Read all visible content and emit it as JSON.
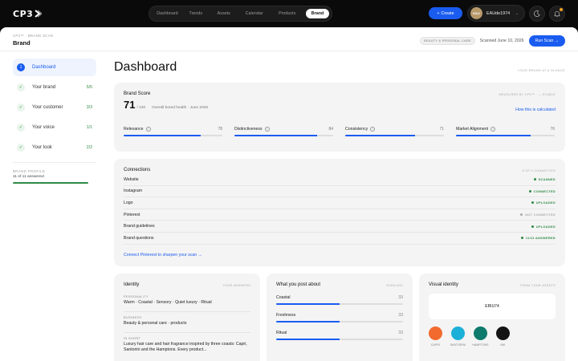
{
  "brand_logo": "CP3",
  "nav": [
    "Dashboard",
    "Trends",
    "Assets",
    "Calendar",
    "Products",
    "Brand"
  ],
  "nav_active": "Brand",
  "create_label": "Create",
  "user": {
    "initials": "EAU",
    "name": "EAUde1974"
  },
  "breadcrumb": "CP3™ · BRAND SCAN",
  "page_title": "Brand",
  "category_tag": "BEAUTY & PERSONAL CARE",
  "scanned": "Scanned June 10, 2026",
  "run_scan": "Run Scan →",
  "sidebar": {
    "items": [
      {
        "icon": "1",
        "label": "Dashboard",
        "count": ""
      },
      {
        "icon": "✓",
        "label": "Your brand",
        "count": "5/5"
      },
      {
        "icon": "✓",
        "label": "Your customer",
        "count": "3/3"
      },
      {
        "icon": "✓",
        "label": "Your voice",
        "count": "1/1"
      },
      {
        "icon": "✓",
        "label": "Your look",
        "count": "2/2"
      }
    ],
    "profile_label": "BRAND PROFILE",
    "profile_value": "11 of 11 answered",
    "profile_progress": 1.0
  },
  "dashboard": {
    "title": "Dashboard",
    "glance": "YOUR BRAND AT A GLANCE"
  },
  "score": {
    "title": "Brand Score",
    "meta": "MEASURED BY CP3™ · → STABLE",
    "value": "71",
    "of": "/ 100",
    "desc": "Overall brand health · June 2026",
    "how_link": "How this is calculated",
    "metrics": [
      {
        "label": "Relevance",
        "value": 78
      },
      {
        "label": "Distinctiveness",
        "value": 84
      },
      {
        "label": "Consistency",
        "value": 71
      },
      {
        "label": "Market Alignment",
        "value": 76
      }
    ]
  },
  "connections": {
    "title": "Connections",
    "meta": "5 OF 6 CONNECTED",
    "rows": [
      {
        "label": "Website",
        "status": "SCANNED",
        "color": "#2e8b46"
      },
      {
        "label": "Instagram",
        "status": "CONNECTED",
        "color": "#2e8b46"
      },
      {
        "label": "Logo",
        "status": "UPLOADED",
        "color": "#2e8b46"
      },
      {
        "label": "Pinterest",
        "status": "NOT CONNECTED",
        "color": "#aaaaaa"
      },
      {
        "label": "Brand guidelines",
        "status": "UPLOADED",
        "color": "#2e8b46"
      },
      {
        "label": "Brand questions",
        "status": "11/11 ANSWERED",
        "color": "#2e8b46"
      }
    ],
    "link": "Connect Pinterest to sharpen your scan →"
  },
  "identity": {
    "title": "Identity",
    "meta": "YOUR ANSWERS",
    "personality_label": "PERSONALITY",
    "personality": "Warm · Coastal · Sensory · Quiet luxury · Ritual",
    "business_label": "BUSINESS",
    "business": "Beauty & personal care · products",
    "short_label": "IN SHORT",
    "short": "Luxury hair care and hair fragrance inspired by three coasts: Capri, Santorini and the Hamptons. Every product..."
  },
  "posts": {
    "title": "What you post about",
    "meta": "EVEN MIX",
    "rows": [
      {
        "label": "Coastal",
        "value": 33
      },
      {
        "label": "Freshness",
        "value": 33
      },
      {
        "label": "Ritual",
        "value": 33
      }
    ]
  },
  "visual": {
    "title": "Visual identity",
    "meta": "FROM YOUR ASSETS",
    "logo_text": "ERIU74",
    "swatches": [
      {
        "name": "CAPRI",
        "color": "#f26a2e"
      },
      {
        "name": "SANTORINI",
        "color": "#1bb0d8"
      },
      {
        "name": "HAMPTONS",
        "color": "#0e7a6c"
      },
      {
        "name": "INK",
        "color": "#141414"
      }
    ]
  },
  "colors": {
    "accent": "#1a5cf0",
    "success": "#2e8b46"
  }
}
